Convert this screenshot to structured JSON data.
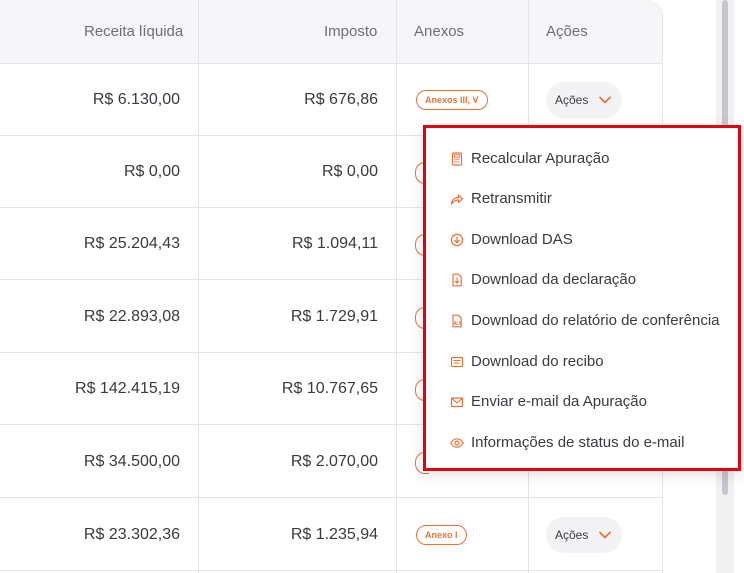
{
  "table": {
    "headers": {
      "receita": "Receita líquida",
      "imposto": "Imposto",
      "anexos": "Anexos",
      "acoes": "Ações"
    },
    "rows": [
      {
        "receita": "R$ 6.130,00",
        "imposto": "R$ 676,86",
        "anexo": "Anexos III, V",
        "acoes_label": "Ações"
      },
      {
        "receita": "R$ 0,00",
        "imposto": "R$ 0,00"
      },
      {
        "receita": "R$ 25.204,43",
        "imposto": "R$ 1.094,11"
      },
      {
        "receita": "R$ 22.893,08",
        "imposto": "R$ 1.729,91"
      },
      {
        "receita": "R$ 142.415,19",
        "imposto": "R$ 10.767,65"
      },
      {
        "receita": "R$ 34.500,00",
        "imposto": "R$ 2.070,00"
      },
      {
        "receita": "R$ 23.302,36",
        "imposto": "R$ 1.235,94",
        "anexo": "Anexo I",
        "acoes_label": "Ações"
      }
    ]
  },
  "menu": {
    "items": [
      {
        "label": "Recalcular Apuração",
        "icon": "calculator-icon"
      },
      {
        "label": "Retransmitir",
        "icon": "share-arrow-icon"
      },
      {
        "label": "Download DAS",
        "icon": "download-circle-icon"
      },
      {
        "label": "Download da declaração",
        "icon": "file-download-icon"
      },
      {
        "label": "Download do relatório de conferência",
        "icon": "xls-file-icon"
      },
      {
        "label": "Download do recibo",
        "icon": "receipt-icon"
      },
      {
        "label": "Enviar e-mail da Apuração",
        "icon": "envelope-icon"
      },
      {
        "label": "Informações de status do e-mail",
        "icon": "eye-icon"
      }
    ]
  },
  "colors": {
    "accent": "#e8743b",
    "highlight_border": "#e3000f"
  }
}
